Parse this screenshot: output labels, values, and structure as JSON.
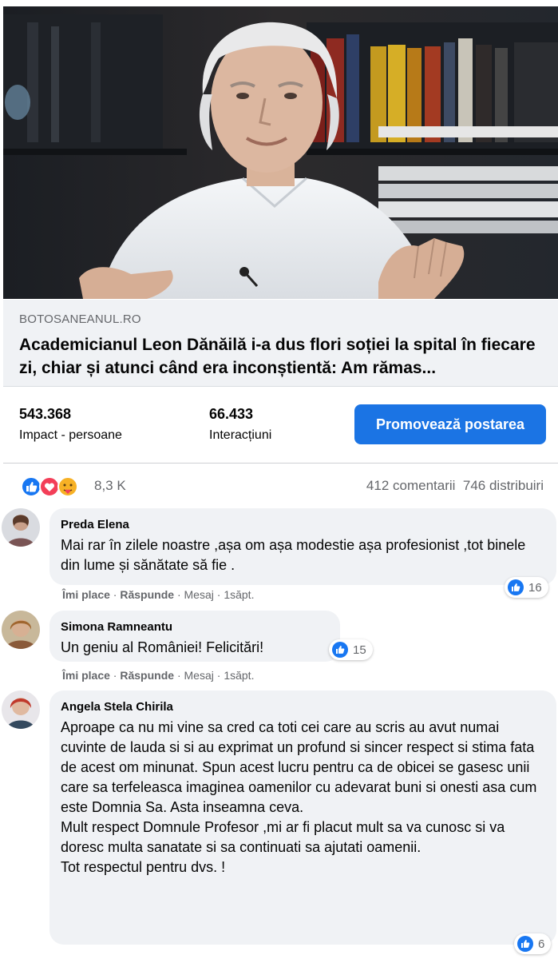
{
  "link_preview": {
    "domain": "BOTOSANEANUL.RO",
    "headline": "Academicianul Leon Dănăilă i-a dus flori soției la spital în fiecare zi, chiar și atunci când era inconștientă: Am rămas..."
  },
  "stats": {
    "reach_value": "543.368",
    "reach_label": "Impact - persoane",
    "engagement_value": "66.433",
    "engagement_label": "Interacțiuni",
    "promote_label": "Promovează postarea"
  },
  "reactions": {
    "icons": [
      "like-icon",
      "love-icon",
      "care-icon"
    ],
    "count": "8,3 K",
    "comments": "412 comentarii",
    "shares": "746 distribuiri"
  },
  "comments": [
    {
      "author": "Preda Elena",
      "text": "Mai rar în zilele noastre ,așa om așa modestie așa profesionist ,tot binele din lume și sănătate să fie .",
      "like": "Îmi place",
      "reply": "Răspunde",
      "message": "Mesaj",
      "time": "1săpt.",
      "likes": "16"
    },
    {
      "author": "Simona Ramneantu",
      "text": "Un geniu al României! Felicitări!",
      "like": "Îmi place",
      "reply": "Răspunde",
      "message": "Mesaj",
      "time": "1săpt.",
      "likes": "15"
    },
    {
      "author": "Angela Stela Chirila",
      "text": "Aproape ca nu mi vine sa cred ca toti cei care au scris au avut numai cuvinte de lauda si si au exprimat un profund si sincer respect si stima fata de acest om minunat. Spun acest lucru pentru ca de obicei se gasesc unii care sa terfeleasca imaginea oamenilor cu adevarat buni si onesti asa cum este Domnia Sa. Asta inseamna ceva.\nMult respect Domnule Profesor ,mi ar fi placut mult sa va cunosc si va doresc multa sanatate si sa continuati sa ajutati oamenii.\nTot respectul pentru dvs. !",
      "likes": "6"
    }
  ],
  "colors": {
    "accent": "#1b74e4",
    "muted_text": "#65676b",
    "bubble": "#f0f2f5",
    "like_blue": "#1877f2",
    "love_red": "#f33e58",
    "care_yellow": "#f7b125"
  }
}
